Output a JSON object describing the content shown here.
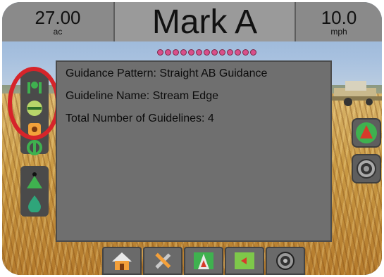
{
  "top_bar": {
    "area_value": "27.00",
    "area_unit": "ac",
    "screen_title": "Mark A",
    "speed_value": "10.0",
    "speed_unit": "mph"
  },
  "lightbar": {
    "led_count": 13,
    "led_color": "#d84f8a"
  },
  "info_panel": {
    "lines": [
      "Guidance Pattern: Straight AB Guidance",
      "Guideline Name: Stream Edge",
      "Total Number of Guidelines: 4"
    ]
  },
  "left_toolbar": {
    "icons": [
      "mark-point-icon",
      "guidance-line-icon",
      "marker-icon",
      "steering-icon",
      "tree-icon",
      "droplet-icon"
    ]
  },
  "right_toolbar": {
    "icons": [
      "navigation-arrow-icon",
      "view-zoom-icon"
    ]
  },
  "bottom_nav": {
    "icons": [
      "home-icon",
      "tools-icon",
      "guidance-view-icon",
      "field-map-icon",
      "camera-icon"
    ]
  },
  "colors": {
    "highlight_ring": "#d6242a",
    "accent_green": "#3fb14f",
    "accent_red": "#d73a2a"
  }
}
